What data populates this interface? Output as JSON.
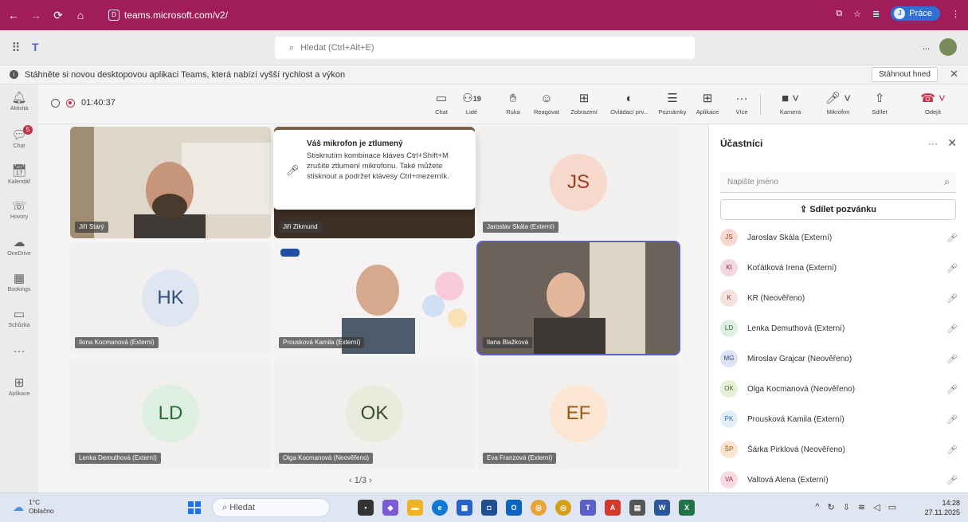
{
  "browser": {
    "url": "teams.microsoft.com/v2/",
    "favicon": "D",
    "profile_label": "Práce",
    "profile_initial": "J"
  },
  "teams_top": {
    "search_placeholder": "Hledat (Ctrl+Alt+E)",
    "more_label": "..."
  },
  "banner": {
    "text": "Stáhněte si novou desktopovou aplikaci Teams, která nabízí vyšší rychlost a výkon",
    "button": "Stáhnout hned"
  },
  "rail": [
    {
      "id": "activity",
      "icon": "bell-icon",
      "glyph": "🔔︎",
      "label": "Aktivita"
    },
    {
      "id": "chat",
      "icon": "chat-icon",
      "glyph": "💬︎",
      "label": "Chat",
      "badge": "5"
    },
    {
      "id": "calendar",
      "icon": "calendar-icon",
      "glyph": "📅︎",
      "label": "Kalendář"
    },
    {
      "id": "calls",
      "icon": "phone-icon",
      "glyph": "☏",
      "label": "Hovory"
    },
    {
      "id": "onedrive",
      "icon": "cloud-icon",
      "glyph": "☁",
      "label": "OneDrive"
    },
    {
      "id": "bookings",
      "icon": "bookings-icon",
      "glyph": "▦",
      "label": "Bookings"
    },
    {
      "id": "meetings",
      "icon": "video-icon",
      "glyph": "▭",
      "label": "Schůzka"
    },
    {
      "id": "more",
      "icon": "more-icon",
      "glyph": "···",
      "label": ""
    },
    {
      "id": "apps",
      "icon": "apps-icon",
      "glyph": "⊞",
      "label": "Aplikace"
    }
  ],
  "meeting": {
    "timer": "01:40:37",
    "people_count": "19",
    "toolbar": {
      "chat": "Chat",
      "people": "Lidé",
      "raise": "Ruka",
      "react": "Reagovat",
      "view": "Zobrazení",
      "controls": "Ovládací prv...",
      "notes": "Poznámky",
      "apps": "Aplikace",
      "more": "Více",
      "camera": "Kamera",
      "mic": "Mikrofon",
      "share": "Sdílet",
      "leave": "Odejít"
    }
  },
  "tiles": [
    {
      "name": "Jiří Starý",
      "type": "video"
    },
    {
      "name": "Jiří Zikmund",
      "type": "video"
    },
    {
      "name": "Jaroslav Skála (Externí)",
      "type": "initials",
      "initials": "JS"
    },
    {
      "name": "Ilona Kocmanová (Externí)",
      "type": "initials",
      "initials": "HK"
    },
    {
      "name": "Prousková Kamila (Externí)",
      "type": "video"
    },
    {
      "name": "Ilana Blažková",
      "type": "video"
    },
    {
      "name": "Lenka Demuthová (Externí)",
      "type": "initials",
      "initials": "LD"
    },
    {
      "name": "Olga Kocmanová (Neověřeno)",
      "type": "initials",
      "initials": "OK"
    },
    {
      "name": "Eva Franzová (Externí)",
      "type": "initials",
      "initials": "EF"
    }
  ],
  "pager": "1/3",
  "mic_popup": {
    "title": "Váš mikrofon je ztlumený",
    "body": "Stisknutím kombinace kláves Ctrl+Shift+M zrušíte ztlumení mikrofonu. Také můžete stisknout a podržet klávesy Ctrl+mezerník."
  },
  "panel": {
    "title": "Účastníci",
    "search_placeholder": "Napište jméno",
    "invite": "Sdílet pozvánku",
    "participants": [
      {
        "initials": "JS",
        "name": "Jaroslav Skála (Externí)",
        "color": "#f7d9cf",
        "text": "#9b3d1f"
      },
      {
        "initials": "KI",
        "name": "Koťátková Irena (Externí)",
        "color": "#f4d7e2",
        "text": "#8a2450"
      },
      {
        "initials": "K",
        "name": "KR (Neověřeno)",
        "color": "#f3e2dd",
        "text": "#7d3b2a"
      },
      {
        "initials": "LD",
        "name": "Lenka Demuthová (Externí)",
        "color": "#dcefe0",
        "text": "#2e6b3a"
      },
      {
        "initials": "MG",
        "name": "Miroslav Grajcar (Neověřeno)",
        "color": "#dde3f5",
        "text": "#36478a"
      },
      {
        "initials": "OK",
        "name": "Olga Kocmanová (Neověřeno)",
        "color": "#e6efd9",
        "text": "#4d6a22"
      },
      {
        "initials": "PK",
        "name": "Prousková Kamila (Externí)",
        "color": "#e1eef8",
        "text": "#2e6b9b"
      },
      {
        "initials": "ŠP",
        "name": "Šárka Pirklová (Neověřeno)",
        "color": "#fbe4cf",
        "text": "#9a5a16"
      },
      {
        "initials": "VA",
        "name": "Valtová Alena (Externí)",
        "color": "#f8dbe0",
        "text": "#a02a40"
      }
    ]
  },
  "taskbar": {
    "temp": "1°C",
    "weather": "Oblačno",
    "search": "Hledat",
    "time": "14:28",
    "date": "27.11.2025"
  }
}
